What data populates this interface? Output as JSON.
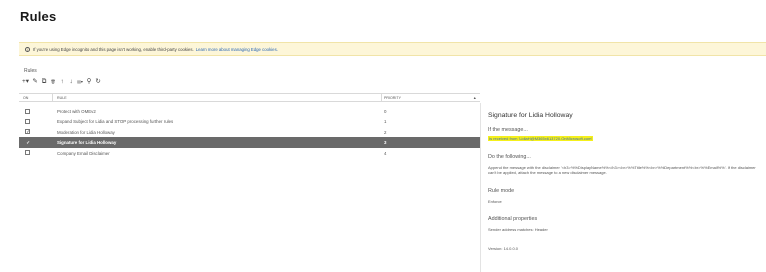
{
  "page": {
    "title": "Rules"
  },
  "banner": {
    "message": "If you're using Edge incognito and this page isn't working, enable third-party cookies.",
    "link": "Learn more about managing Edge cookies."
  },
  "section_label": "Rules",
  "toolbar": [
    {
      "icon": "add-icon",
      "glyph": "+▾"
    },
    {
      "icon": "edit-icon",
      "glyph": "✎"
    },
    {
      "icon": "copy-icon",
      "glyph": "⧉"
    },
    {
      "icon": "delete-icon",
      "glyph": "🗑"
    },
    {
      "icon": "move-up-icon",
      "glyph": "↑"
    },
    {
      "icon": "move-down-icon",
      "glyph": "↓"
    },
    {
      "icon": "more-icon",
      "glyph": "▤▾"
    },
    {
      "icon": "search-icon",
      "glyph": "⚲"
    },
    {
      "icon": "refresh-icon",
      "glyph": "↻"
    }
  ],
  "grid": {
    "columns": {
      "on": "ON",
      "rule": "RULE",
      "priority": "PRIORITY",
      "sort": "▲"
    },
    "rows": [
      {
        "on": false,
        "name": "Protect with OMEv2",
        "priority": "0",
        "selected": false
      },
      {
        "on": false,
        "name": "Expand Subject for Lidia and STOP processing further rules",
        "priority": "1",
        "selected": false
      },
      {
        "on": true,
        "name": "Moderation for Lidia Holloway",
        "priority": "2",
        "selected": false
      },
      {
        "on": true,
        "name": "Signature for Lidia Holloway",
        "priority": "3",
        "selected": true
      },
      {
        "on": false,
        "name": "Company Email Disclaimer",
        "priority": "4",
        "selected": false
      }
    ]
  },
  "detail": {
    "title": "Signature for Lidia Holloway",
    "if_label": "If the message...",
    "condition": "Is received from 'LidiaH@M365x613720.OnMicrosoft.com'",
    "do_label": "Do the following...",
    "action": "Append the message with the disclaimer '<h3>%%DisplayName%%</h3><br>%%Title%%<br>%%Department%%<br>%%Email%%'. If the disclaimer can't be applied, attach the message to a new disclaimer message.",
    "mode_label": "Rule mode",
    "mode_value": "Enforce",
    "props_label": "Additional properties",
    "props_value": "Sender address matches: Header",
    "version": "Version: 14.0.0.0"
  },
  "colors": {
    "selected_row": "#6a6a6a",
    "banner_bg": "#fdf6d8",
    "highlight": "#f5f01b",
    "link": "#2a67b6"
  }
}
